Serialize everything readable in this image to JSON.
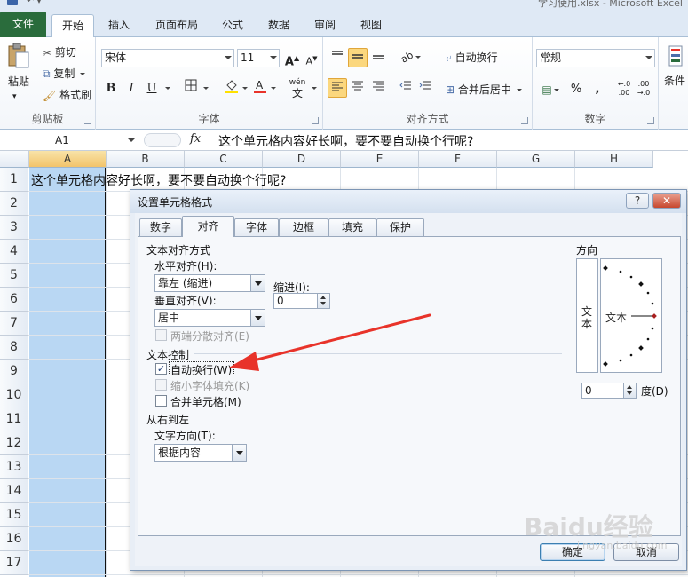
{
  "window": {
    "title": "学习使用.xlsx - Microsoft Excel"
  },
  "ribbon_tabs": [
    "文件",
    "开始",
    "插入",
    "页面布局",
    "公式",
    "数据",
    "审阅",
    "视图"
  ],
  "active_tab": "开始",
  "clipboard": {
    "paste": "粘贴",
    "cut": "剪切",
    "copy": "复制",
    "format_painter": "格式刷",
    "group_label": "剪贴板"
  },
  "font": {
    "name": "宋体",
    "size": "11",
    "bold": "B",
    "italic": "I",
    "underline": "U",
    "phonetic": "wén",
    "group_label": "字体"
  },
  "alignment": {
    "wrap_text": "自动换行",
    "merge_center": "合并后居中",
    "group_label": "对齐方式"
  },
  "number": {
    "format": "常规",
    "percent": "%",
    "comma": ",",
    "group_label": "数字"
  },
  "styles": {
    "conditional": "条件"
  },
  "formula_bar": {
    "name_box": "A1",
    "fx": "fx",
    "content": "这个单元格内容好长啊，要不要自动换个行呢?"
  },
  "sheet": {
    "columns": [
      "A",
      "B",
      "C",
      "D",
      "E",
      "F",
      "G",
      "H"
    ],
    "rows": [
      "1",
      "2",
      "3",
      "4",
      "5",
      "6",
      "7",
      "8",
      "9",
      "10",
      "11",
      "12",
      "13",
      "14",
      "15",
      "16",
      "17"
    ],
    "a1": "这个单元格内容好长啊，要不要自动换个行呢?"
  },
  "dialog": {
    "title": "设置单元格格式",
    "help": "?",
    "close": "✕",
    "tabs": [
      "数字",
      "对齐",
      "字体",
      "边框",
      "填充",
      "保护"
    ],
    "active_tab": "对齐",
    "text_alignment": {
      "section": "文本对齐方式",
      "horizontal_label": "水平对齐(H):",
      "horizontal_value": "靠左 (缩进)",
      "vertical_label": "垂直对齐(V):",
      "vertical_value": "居中",
      "indent_label": "缩进(I):",
      "indent_value": "0",
      "justify_distributed": "两端分散对齐(E)"
    },
    "text_control": {
      "section": "文本控制",
      "wrap_text": "自动换行(W)",
      "wrap_text_checked": true,
      "shrink_to_fit": "缩小字体填充(K)",
      "merge_cells": "合并单元格(M)"
    },
    "rtl": {
      "section": "从右到左",
      "direction_label": "文字方向(T):",
      "direction_value": "根据内容"
    },
    "orientation": {
      "section": "方向",
      "vertical_text": "文本",
      "dial_text": "文本",
      "degrees_value": "0",
      "degrees_label": "度(D)"
    },
    "buttons": {
      "ok": "确定",
      "cancel": "取消"
    }
  },
  "watermark": {
    "text": "Baidu经验",
    "url": "jingyan.baidu.com"
  },
  "colors": {
    "file_tab": "#2a6c3c",
    "selected_column": "#b9d7f3",
    "arrow": "#e8332a",
    "highlight_button": "#fbd77e"
  }
}
